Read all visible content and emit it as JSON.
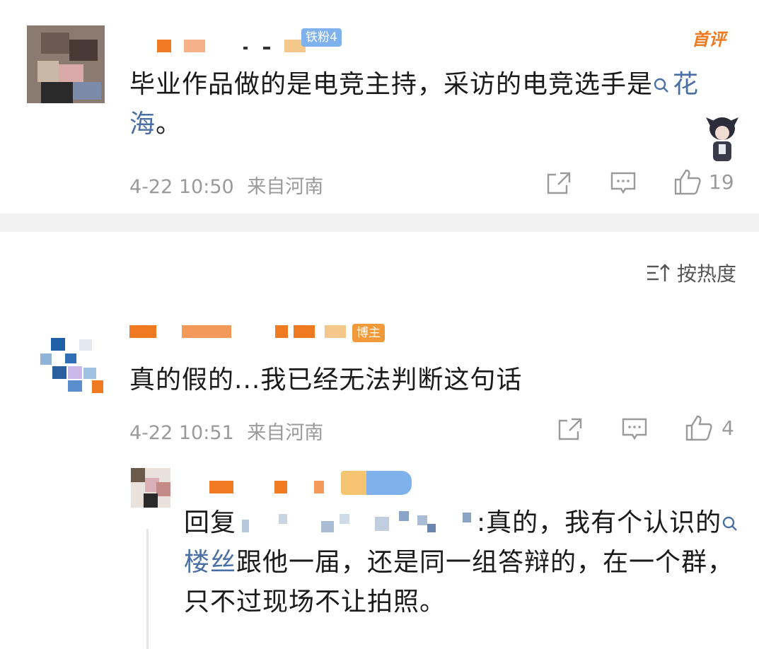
{
  "comment1": {
    "badge": "铁粉4",
    "first_tag": "首评",
    "text_before_topic": "毕业作品做的是电竞主持，采访的电竞选手是",
    "topic": "花海",
    "text_after_topic": "。",
    "time": "4-22 10:50",
    "location": "来自河南",
    "likes": "19"
  },
  "sort": {
    "label": "按热度"
  },
  "comment2": {
    "badge": "博主",
    "text": "真的假的...我已经无法判断这句话",
    "time": "4-22 10:51",
    "location": "来自河南",
    "likes": "4"
  },
  "reply": {
    "prefix": "回复",
    "text_after_name": ":真的，我有个认识的",
    "topic": "楼丝",
    "text_after_topic": "跟他一届，还是同一组答辩的，在一个群，只不过现场不让拍照。"
  },
  "colors": {
    "topic_blue": "#4a6fa5",
    "first_tag_orange": "#f07a22",
    "name_orange": "#f07a22",
    "badge_blue": "#6aa0e8",
    "badge_orange": "#f09a3a",
    "meta_gray": "#9a9a9a"
  },
  "icons": [
    "share-icon",
    "comment-icon",
    "like-icon",
    "sort-icon",
    "search-topic-icon"
  ]
}
